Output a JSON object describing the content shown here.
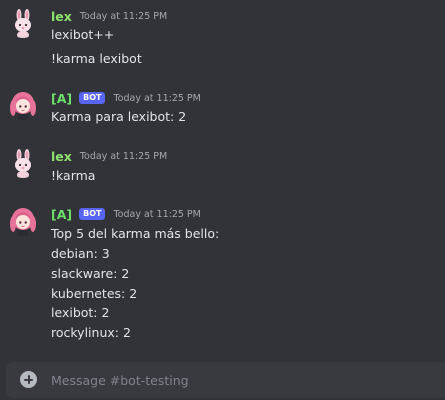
{
  "messages": [
    {
      "author": "lex",
      "timestamp": "Today at 11:25 PM",
      "lines": [
        "lexibot++",
        "!karma lexibot"
      ]
    },
    {
      "author": "[A]",
      "bot_tag": "BOT",
      "timestamp": "Today at 11:25 PM",
      "lines": [
        "Karma para lexibot: 2"
      ]
    },
    {
      "author": "lex",
      "timestamp": "Today at 11:25 PM",
      "lines": [
        "!karma"
      ]
    },
    {
      "author": "[A]",
      "bot_tag": "BOT",
      "timestamp": "Today at 11:25 PM",
      "lines": [
        "Top 5 del karma más bello:",
        "debian: 3",
        "slackware: 2",
        "kubernetes: 2",
        "lexibot: 2",
        "rockylinux: 2"
      ]
    }
  ],
  "composer": {
    "placeholder": "Message #bot-testing",
    "value": ""
  },
  "colors": {
    "background": "#313338",
    "lex_name": "#8de36d",
    "bot_name": "#6ee06a",
    "bot_tag": "#5865f2"
  },
  "icons": {
    "add": "plus-circle-icon",
    "lex_avatar": "pink-bunny-avatar",
    "bot_avatar": "anime-girl-avatar"
  }
}
